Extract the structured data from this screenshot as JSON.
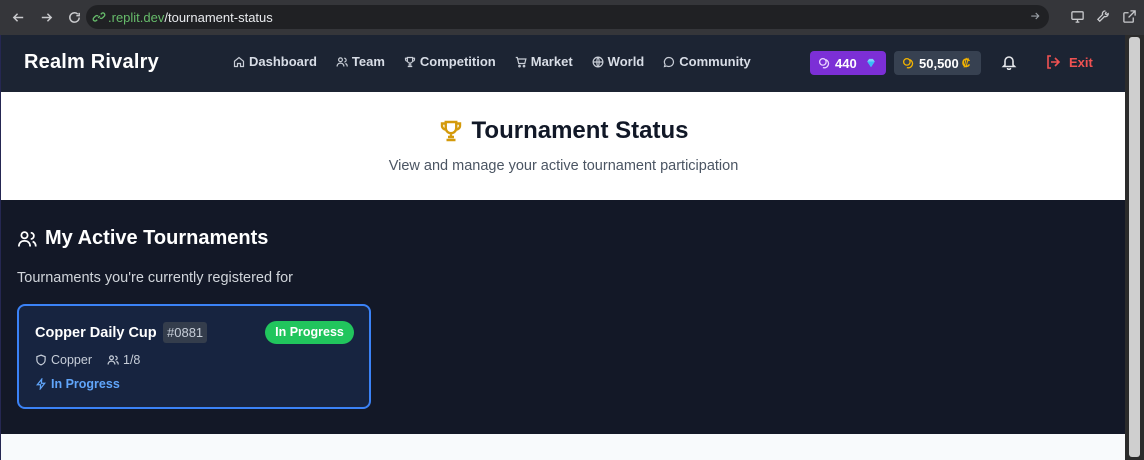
{
  "browser": {
    "url_host": ".replit.dev",
    "url_path": "/tournament-status"
  },
  "app": {
    "brand": "Realm Rivalry",
    "nav": [
      {
        "label": "Dashboard",
        "icon": "home-icon"
      },
      {
        "label": "Team",
        "icon": "users-icon"
      },
      {
        "label": "Competition",
        "icon": "trophy-icon"
      },
      {
        "label": "Market",
        "icon": "cart-icon"
      },
      {
        "label": "World",
        "icon": "globe-icon"
      },
      {
        "label": "Community",
        "icon": "chat-bubble-icon"
      }
    ],
    "gems": "440",
    "credits": "50,500",
    "credits_symbol": "₡",
    "exit_label": "Exit"
  },
  "hero": {
    "title": "Tournament Status",
    "subtitle": "View and manage your active tournament participation"
  },
  "section": {
    "title": "My Active Tournaments",
    "subtitle": "Tournaments you're currently registered for"
  },
  "tournament": {
    "name": "Copper Daily Cup",
    "id": "#0881",
    "status_badge": "In Progress",
    "division": "Copper",
    "participants": "1/8",
    "progress_label": "In Progress"
  },
  "colors": {
    "accent_purple": "#7c2fd6",
    "status_green": "#21c55d",
    "card_border": "#3b82f6",
    "exit_red": "#f05252"
  }
}
